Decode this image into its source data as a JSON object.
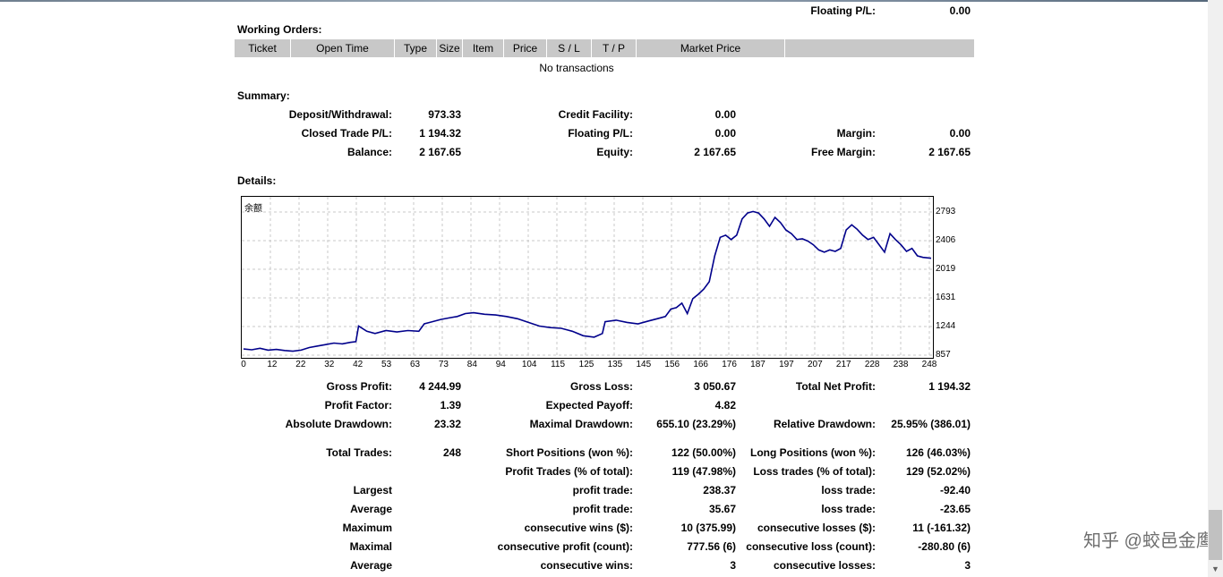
{
  "top": {
    "floating_pl_label": "Floating P/L:",
    "floating_pl_value": "0.00"
  },
  "working_orders": {
    "title": "Working Orders:",
    "columns": [
      "Ticket",
      "Open Time",
      "Type",
      "Size",
      "Item",
      "Price",
      "S / L",
      "T / P",
      "Market Price",
      ""
    ],
    "empty_text": "No transactions"
  },
  "summary": {
    "title": "Summary:",
    "deposit_label": "Deposit/Withdrawal:",
    "deposit_value": "973.33",
    "credit_label": "Credit Facility:",
    "credit_value": "0.00",
    "closed_pl_label": "Closed Trade P/L:",
    "closed_pl_value": "1 194.32",
    "floating_label": "Floating P/L:",
    "floating_value": "0.00",
    "margin_label": "Margin:",
    "margin_value": "0.00",
    "balance_label": "Balance:",
    "balance_value": "2 167.65",
    "equity_label": "Equity:",
    "equity_value": "2 167.65",
    "free_margin_label": "Free Margin:",
    "free_margin_value": "2 167.65"
  },
  "details": {
    "title": "Details:"
  },
  "chart_data": {
    "type": "line",
    "title": "余额",
    "x_ticks": [
      "0",
      "12",
      "22",
      "32",
      "42",
      "53",
      "63",
      "73",
      "84",
      "94",
      "104",
      "115",
      "125",
      "135",
      "145",
      "156",
      "166",
      "176",
      "187",
      "197",
      "207",
      "217",
      "228",
      "238",
      "248"
    ],
    "y_ticks": [
      "2793",
      "2406",
      "2019",
      "1631",
      "1244",
      "857"
    ],
    "xlim": [
      0,
      251
    ],
    "ylim": [
      857,
      2793
    ],
    "grid": true,
    "series": [
      {
        "color": "#00008b",
        "x": [
          0,
          3,
          6,
          9,
          12,
          15,
          18,
          21,
          24,
          27,
          30,
          33,
          36,
          39,
          41,
          42,
          45,
          48,
          52,
          56,
          60,
          64,
          66,
          68,
          72,
          75,
          78,
          81,
          84,
          88,
          92,
          96,
          100,
          104,
          108,
          112,
          116,
          120,
          124,
          128,
          131,
          132,
          136,
          140,
          144,
          148,
          151,
          154,
          156,
          158,
          160,
          162,
          164,
          166,
          168,
          170,
          172,
          174,
          176,
          178,
          180,
          182,
          184,
          186,
          188,
          190,
          192,
          194,
          196,
          198,
          200,
          202,
          204,
          206,
          208,
          210,
          212,
          214,
          216,
          218,
          220,
          222,
          224,
          226,
          228,
          230,
          232,
          234,
          236,
          238,
          240,
          242,
          244,
          246,
          248,
          251
        ],
        "y": [
          940,
          930,
          950,
          925,
          935,
          920,
          910,
          925,
          960,
          980,
          1000,
          1020,
          1010,
          1030,
          1040,
          1250,
          1180,
          1150,
          1190,
          1170,
          1190,
          1180,
          1280,
          1300,
          1340,
          1360,
          1380,
          1420,
          1430,
          1410,
          1400,
          1380,
          1350,
          1300,
          1250,
          1230,
          1220,
          1180,
          1120,
          1100,
          1150,
          1310,
          1330,
          1300,
          1280,
          1320,
          1350,
          1380,
          1480,
          1500,
          1560,
          1420,
          1620,
          1680,
          1750,
          1850,
          2200,
          2450,
          2480,
          2420,
          2480,
          2700,
          2780,
          2800,
          2780,
          2700,
          2600,
          2720,
          2650,
          2550,
          2500,
          2420,
          2430,
          2400,
          2350,
          2280,
          2250,
          2280,
          2260,
          2300,
          2550,
          2620,
          2560,
          2480,
          2420,
          2450,
          2350,
          2250,
          2500,
          2420,
          2350,
          2260,
          2300,
          2200,
          2180,
          2167.65
        ]
      }
    ]
  },
  "stats": {
    "gross_profit_label": "Gross Profit:",
    "gross_profit_value": "4 244.99",
    "gross_loss_label": "Gross Loss:",
    "gross_loss_value": "3 050.67",
    "total_net_label": "Total Net Profit:",
    "total_net_value": "1 194.32",
    "profit_factor_label": "Profit Factor:",
    "profit_factor_value": "1.39",
    "expected_payoff_label": "Expected Payoff:",
    "expected_payoff_value": "4.82",
    "abs_drawdown_label": "Absolute Drawdown:",
    "abs_drawdown_value": "23.32",
    "max_drawdown_label": "Maximal Drawdown:",
    "max_drawdown_value": "655.10 (23.29%)",
    "rel_drawdown_label": "Relative Drawdown:",
    "rel_drawdown_value": "25.95% (386.01)",
    "total_trades_label": "Total Trades:",
    "total_trades_value": "248",
    "short_label": "Short Positions (won %):",
    "short_value": "122 (50.00%)",
    "long_label": "Long Positions (won %):",
    "long_value": "126 (46.03%)",
    "profit_trades_label": "Profit Trades (% of total):",
    "profit_trades_value": "119 (47.98%)",
    "loss_trades_label": "Loss trades (% of total):",
    "loss_trades_value": "129 (52.02%)",
    "largest_label": "Largest",
    "largest_profit_label": "profit trade:",
    "largest_profit_value": "238.37",
    "largest_loss_label": "loss trade:",
    "largest_loss_value": "-92.40",
    "average_label": "Average",
    "average_profit_label": "profit trade:",
    "average_profit_value": "35.67",
    "average_loss_label": "loss trade:",
    "average_loss_value": "-23.65",
    "maximum_label": "Maximum",
    "max_wins_label": "consecutive wins ($):",
    "max_wins_value": "10 (375.99)",
    "max_losses_label": "consecutive losses ($):",
    "max_losses_value": "11 (-161.32)",
    "maximal_label": "Maximal",
    "maximal_profit_label": "consecutive profit (count):",
    "maximal_profit_value": "777.56 (6)",
    "maximal_loss_label": "consecutive loss (count):",
    "maximal_loss_value": "-280.80 (6)",
    "average2_label": "Average",
    "avg_wins_label": "consecutive wins:",
    "avg_wins_value": "3",
    "avg_losses_label": "consecutive losses:",
    "avg_losses_value": "3"
  },
  "watermark": "知乎 @蛟邑金鹰",
  "scroll_down_icon": "arrow-down-icon"
}
